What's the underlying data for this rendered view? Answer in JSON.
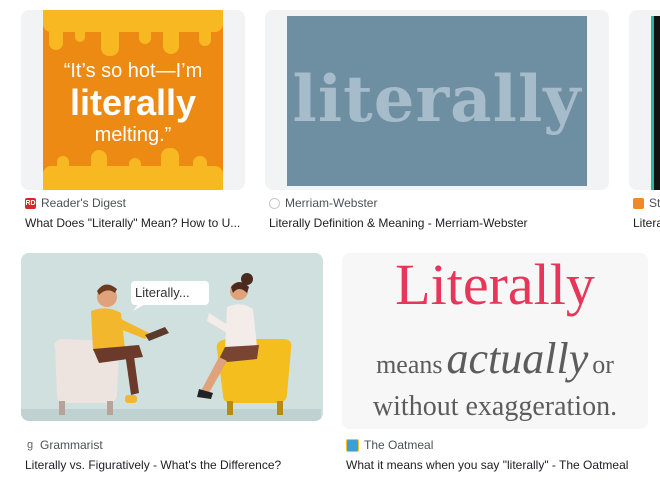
{
  "results": [
    {
      "source": "Reader's Digest",
      "title": "What Does \"Literally\" Mean? How to U...",
      "image": {
        "line1": "“It’s so hot—I’m",
        "line2": "literally",
        "line3": "melting.”"
      },
      "favicon_color": "#d9262d",
      "favicon_text": "RD"
    },
    {
      "source": "Merriam-Webster",
      "title": "Literally Definition & Meaning - Merriam-Webster",
      "image": {
        "word": "literally"
      },
      "favicon_color": "#c9c9c9",
      "favicon_text": ""
    },
    {
      "source": "St",
      "title": "Litera",
      "favicon_color": "#f08a24",
      "favicon_text": ""
    },
    {
      "source": "Grammarist",
      "title": "Literally vs. Figuratively - What's the Difference?",
      "image": {
        "bubble": "Literally..."
      },
      "favicon_text": "g"
    },
    {
      "source": "The Oatmeal",
      "title": "What it means when you say \"literally\" - The Oatmeal",
      "image": {
        "line1": "Literally",
        "line2_a": "means",
        "line2_b": "actually",
        "line2_c": "or",
        "line3": "without exaggeration."
      },
      "favicon_color": "#3aa0d8",
      "favicon_text": ""
    }
  ],
  "colors": {
    "oatmeal_red": "#e8355a",
    "oatmeal_gray": "#5c5c5c",
    "rd_orange": "#ec8a14",
    "mw_blue": "#6e8fa1"
  }
}
